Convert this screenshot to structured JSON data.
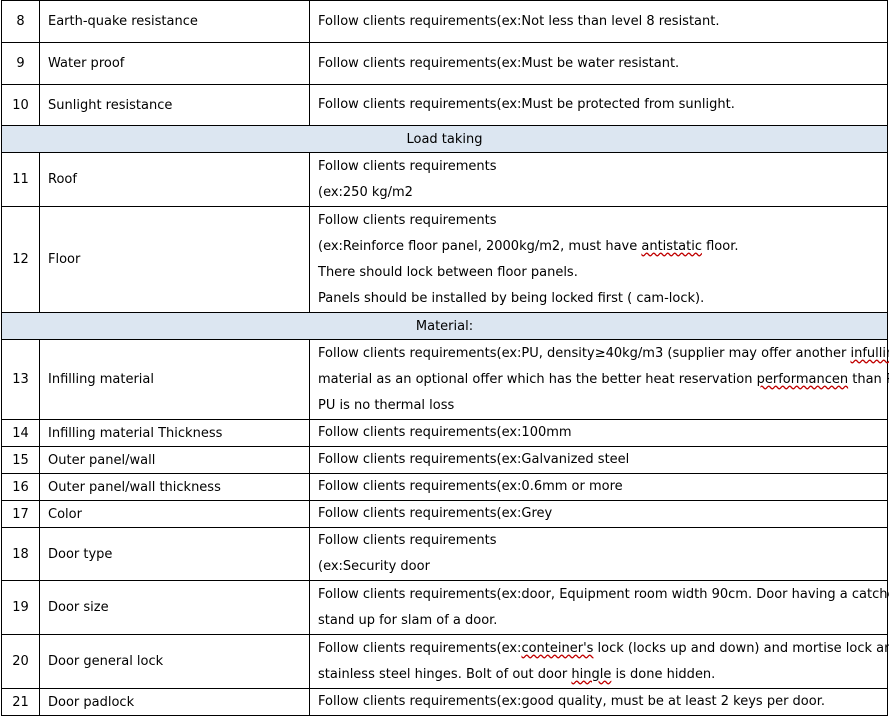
{
  "rows_top": [
    {
      "num": "8",
      "item": "Earth-quake resistance",
      "lines": [
        "Follow clients requirements(ex:Not less than level 8 resistant."
      ]
    },
    {
      "num": "9",
      "item": "Water proof",
      "lines": [
        "Follow clients requirements(ex:Must be water resistant."
      ]
    },
    {
      "num": "10",
      "item": "Sunlight resistance",
      "lines": [
        "Follow clients requirements(ex:Must be protected from sunlight."
      ]
    }
  ],
  "section_load": "Load taking",
  "roof": {
    "num": "11",
    "item": "Roof",
    "lines": [
      "Follow clients requirements",
      "(ex:250 kg/m2"
    ]
  },
  "floor": {
    "num": "12",
    "item": "Floor",
    "line1": "Follow clients requirements",
    "line2_pre": "(ex:Reinforce floor panel, 2000kg/m2, must have ",
    "line2_mark": "antistatic",
    "line2_post": " floor.",
    "line3": "There should lock between floor panels.",
    "line4": "Panels should be installed by being locked first ( cam-lock)."
  },
  "section_material": "Material:",
  "infill": {
    "num": "13",
    "item": "Infilling material",
    "line1_pre": "Follow clients requirements(ex:PU, density≥40kg/m3   (supplier may offer another ",
    "line1_mark": "infulling",
    "line2_pre": "material as an optional offer which has the better heat reservation ",
    "line2_mark": "performancen",
    "line2_post": " than PU)",
    "line3": "PU is no thermal loss"
  },
  "rows_mid": [
    {
      "num": "14",
      "item": "Infilling material Thickness",
      "lines": [
        "Follow clients requirements(ex:100mm"
      ]
    },
    {
      "num": "15",
      "item": "Outer panel/wall",
      "lines": [
        "Follow clients requirements(ex:Galvanized steel"
      ]
    },
    {
      "num": "16",
      "item": "Outer panel/wall thickness",
      "lines": [
        "Follow clients requirements(ex:0.6mm or more"
      ]
    },
    {
      "num": "17",
      "item": "Color",
      "lines": [
        "Follow clients requirements(ex:Grey"
      ]
    },
    {
      "num": "18",
      "item": "Door type",
      "lines": [
        "Follow clients requirements",
        "(ex:Security door"
      ]
    },
    {
      "num": "19",
      "item": "Door size",
      "lines": [
        "Follow clients requirements(ex:door, Equipment room width 90cm. Door having a catcher",
        "stand up for slam of a door."
      ]
    }
  ],
  "lock": {
    "num": "20",
    "item": "Door general lock",
    "line1_pre": "Follow clients requirements(ex:",
    "line1_mark": "conteiner's",
    "line1_post": " lock (locks up and down) and mortise lock and",
    "line2_pre": "stainless steel hinges. Bolt of out door ",
    "line2_mark": "hingle",
    "line2_post": " is done hidden."
  },
  "padlock": {
    "num": "21",
    "item": "Door padlock",
    "lines": [
      "Follow clients requirements(ex:good quality, must be at least 2 keys per door."
    ]
  }
}
